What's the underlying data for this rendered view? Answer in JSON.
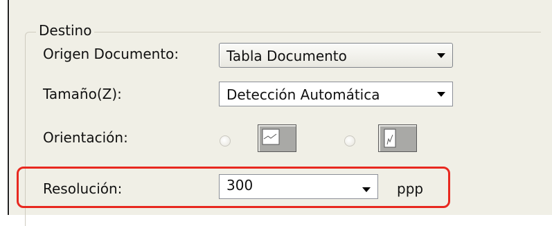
{
  "group": {
    "title": "Destino"
  },
  "rows": {
    "source": {
      "label": "Origen Documento:",
      "value": "Tabla Documento"
    },
    "size": {
      "label": "Tamaño(Z):",
      "value": "Detección Automática"
    },
    "orientation": {
      "label": "Orientación:",
      "options": [
        {
          "name": "portrait",
          "icon": "portrait-page-icon",
          "selected": false
        },
        {
          "name": "landscape",
          "icon": "landscape-page-icon",
          "selected": false
        }
      ]
    },
    "resolution": {
      "label": "Resolución:",
      "value": "300",
      "unit": "ppp"
    }
  },
  "colors": {
    "highlight": "#e8281f",
    "panel": "#f0efe6"
  }
}
